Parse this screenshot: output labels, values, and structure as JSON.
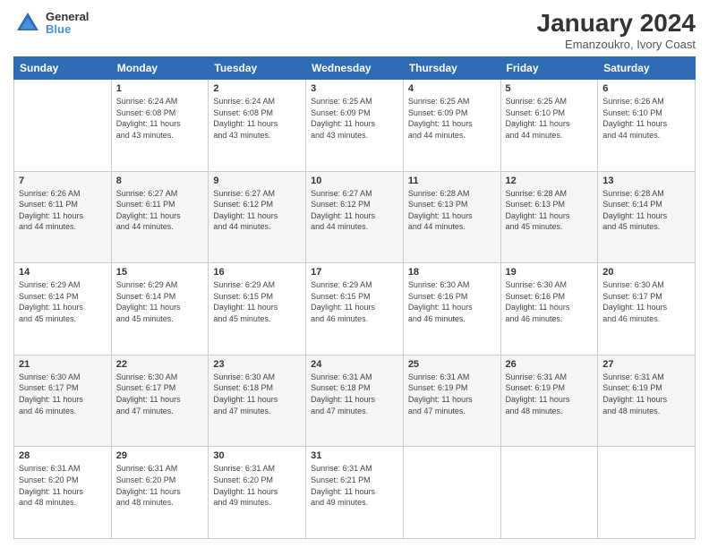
{
  "header": {
    "logo_line1": "General",
    "logo_line2": "Blue",
    "title": "January 2024",
    "subtitle": "Emanzoukro, Ivory Coast"
  },
  "days_of_week": [
    "Sunday",
    "Monday",
    "Tuesday",
    "Wednesday",
    "Thursday",
    "Friday",
    "Saturday"
  ],
  "weeks": [
    [
      {
        "day": "",
        "info": ""
      },
      {
        "day": "1",
        "info": "Sunrise: 6:24 AM\nSunset: 6:08 PM\nDaylight: 11 hours\nand 43 minutes."
      },
      {
        "day": "2",
        "info": "Sunrise: 6:24 AM\nSunset: 6:08 PM\nDaylight: 11 hours\nand 43 minutes."
      },
      {
        "day": "3",
        "info": "Sunrise: 6:25 AM\nSunset: 6:09 PM\nDaylight: 11 hours\nand 43 minutes."
      },
      {
        "day": "4",
        "info": "Sunrise: 6:25 AM\nSunset: 6:09 PM\nDaylight: 11 hours\nand 44 minutes."
      },
      {
        "day": "5",
        "info": "Sunrise: 6:25 AM\nSunset: 6:10 PM\nDaylight: 11 hours\nand 44 minutes."
      },
      {
        "day": "6",
        "info": "Sunrise: 6:26 AM\nSunset: 6:10 PM\nDaylight: 11 hours\nand 44 minutes."
      }
    ],
    [
      {
        "day": "7",
        "info": "Sunrise: 6:26 AM\nSunset: 6:11 PM\nDaylight: 11 hours\nand 44 minutes."
      },
      {
        "day": "8",
        "info": "Sunrise: 6:27 AM\nSunset: 6:11 PM\nDaylight: 11 hours\nand 44 minutes."
      },
      {
        "day": "9",
        "info": "Sunrise: 6:27 AM\nSunset: 6:12 PM\nDaylight: 11 hours\nand 44 minutes."
      },
      {
        "day": "10",
        "info": "Sunrise: 6:27 AM\nSunset: 6:12 PM\nDaylight: 11 hours\nand 44 minutes."
      },
      {
        "day": "11",
        "info": "Sunrise: 6:28 AM\nSunset: 6:13 PM\nDaylight: 11 hours\nand 44 minutes."
      },
      {
        "day": "12",
        "info": "Sunrise: 6:28 AM\nSunset: 6:13 PM\nDaylight: 11 hours\nand 45 minutes."
      },
      {
        "day": "13",
        "info": "Sunrise: 6:28 AM\nSunset: 6:14 PM\nDaylight: 11 hours\nand 45 minutes."
      }
    ],
    [
      {
        "day": "14",
        "info": "Sunrise: 6:29 AM\nSunset: 6:14 PM\nDaylight: 11 hours\nand 45 minutes."
      },
      {
        "day": "15",
        "info": "Sunrise: 6:29 AM\nSunset: 6:14 PM\nDaylight: 11 hours\nand 45 minutes."
      },
      {
        "day": "16",
        "info": "Sunrise: 6:29 AM\nSunset: 6:15 PM\nDaylight: 11 hours\nand 45 minutes."
      },
      {
        "day": "17",
        "info": "Sunrise: 6:29 AM\nSunset: 6:15 PM\nDaylight: 11 hours\nand 46 minutes."
      },
      {
        "day": "18",
        "info": "Sunrise: 6:30 AM\nSunset: 6:16 PM\nDaylight: 11 hours\nand 46 minutes."
      },
      {
        "day": "19",
        "info": "Sunrise: 6:30 AM\nSunset: 6:16 PM\nDaylight: 11 hours\nand 46 minutes."
      },
      {
        "day": "20",
        "info": "Sunrise: 6:30 AM\nSunset: 6:17 PM\nDaylight: 11 hours\nand 46 minutes."
      }
    ],
    [
      {
        "day": "21",
        "info": "Sunrise: 6:30 AM\nSunset: 6:17 PM\nDaylight: 11 hours\nand 46 minutes."
      },
      {
        "day": "22",
        "info": "Sunrise: 6:30 AM\nSunset: 6:17 PM\nDaylight: 11 hours\nand 47 minutes."
      },
      {
        "day": "23",
        "info": "Sunrise: 6:30 AM\nSunset: 6:18 PM\nDaylight: 11 hours\nand 47 minutes."
      },
      {
        "day": "24",
        "info": "Sunrise: 6:31 AM\nSunset: 6:18 PM\nDaylight: 11 hours\nand 47 minutes."
      },
      {
        "day": "25",
        "info": "Sunrise: 6:31 AM\nSunset: 6:19 PM\nDaylight: 11 hours\nand 47 minutes."
      },
      {
        "day": "26",
        "info": "Sunrise: 6:31 AM\nSunset: 6:19 PM\nDaylight: 11 hours\nand 48 minutes."
      },
      {
        "day": "27",
        "info": "Sunrise: 6:31 AM\nSunset: 6:19 PM\nDaylight: 11 hours\nand 48 minutes."
      }
    ],
    [
      {
        "day": "28",
        "info": "Sunrise: 6:31 AM\nSunset: 6:20 PM\nDaylight: 11 hours\nand 48 minutes."
      },
      {
        "day": "29",
        "info": "Sunrise: 6:31 AM\nSunset: 6:20 PM\nDaylight: 11 hours\nand 48 minutes."
      },
      {
        "day": "30",
        "info": "Sunrise: 6:31 AM\nSunset: 6:20 PM\nDaylight: 11 hours\nand 49 minutes."
      },
      {
        "day": "31",
        "info": "Sunrise: 6:31 AM\nSunset: 6:21 PM\nDaylight: 11 hours\nand 49 minutes."
      },
      {
        "day": "",
        "info": ""
      },
      {
        "day": "",
        "info": ""
      },
      {
        "day": "",
        "info": ""
      }
    ]
  ]
}
